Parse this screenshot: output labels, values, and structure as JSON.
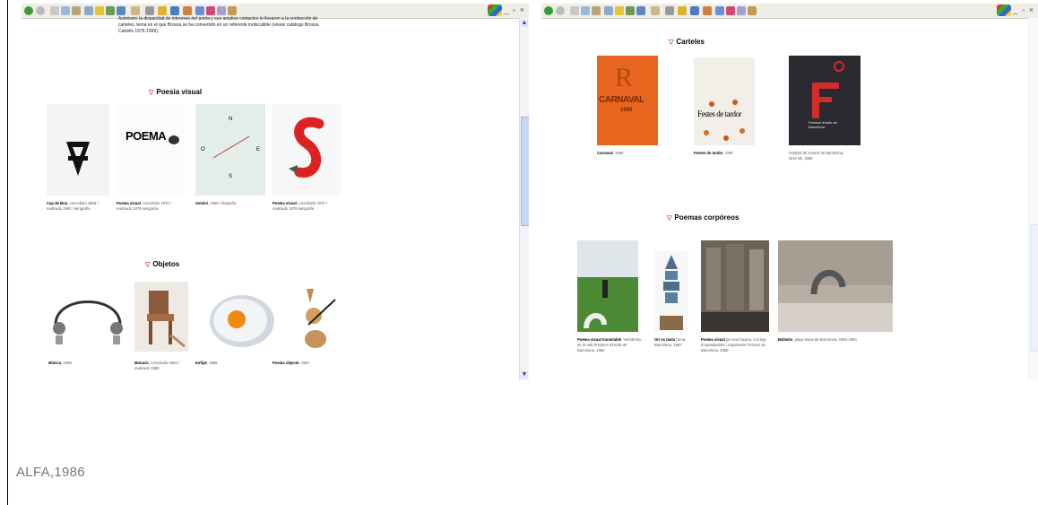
{
  "caption": "ALFA,1986",
  "left_panel": {
    "intro_text": "Asimismo la disparidad de intereses del poeta y sus amplios contactos lo llevaron a la confección de carteles, tema en el que Brossa se ha convertido en un referente indiscutible (véase catálogo Brossa Cartells 1975-1999).",
    "section_visual": "Poesia visual",
    "visual_items": [
      {
        "title": "Cap de Bou",
        "rest": ", concebido 1969 / realizado 1982 / serigrafía"
      },
      {
        "title": "Poema visual",
        "rest": ", concebido 1970 / realizado 1979 serigrafía"
      },
      {
        "title": "Sololoi",
        "rest": ", 1969 / litografía"
      },
      {
        "title": "Poema visual",
        "rest": ", concebido 1970 / realizado 1979 serigrafía"
      }
    ],
    "poema_word": "POEMA",
    "section_objects": "Objetos",
    "object_items": [
      {
        "title": "Música",
        "rest": ", 1965"
      },
      {
        "title": "Mutacio",
        "rest": ", concebido 1964 / realizado 1989"
      },
      {
        "title": "Enfijat",
        "rest": ", 1968"
      },
      {
        "title": "Poema objecte",
        "rest": ", 1967"
      }
    ]
  },
  "right_panel": {
    "section_posters": "Carteles",
    "poster_items": [
      {
        "title": "Carnaval",
        "rest": ", 1980"
      },
      {
        "title": "Festes de tardor",
        "rest": ", 1987"
      },
      {
        "title": "",
        "rest": "Festival de verano de Barcelona: Grec 85, 1985"
      }
    ],
    "poster1_text": "CARNAVAL",
    "poster1_year": "1980",
    "poster2_text": "Festes de tardor",
    "poster3_text": "Festival d'estiu de Barcelona",
    "section_corporeal": "Poemas corpóreos",
    "corporeal_items": [
      {
        "title": "Poema visual transitable",
        "rest": ", Velòdromo de la Vall d'Hebron d'Horta de Barcelona, 1984"
      },
      {
        "title": "Ori so bada",
        "rest": " l'ama, Barcelona, 1987"
      },
      {
        "title": "Poema visual",
        "rest": " per una façana, Col·legi d'Aparelladors i Arquitectes Tècnics de Barcelona, 1990"
      },
      {
        "title": "Bàlimbs",
        "rest": ", plaça Nova de Barcelona, 1991-1994"
      }
    ]
  },
  "window_controls": "_ ▫ ×",
  "colors": {
    "accent_red": "#cc3333",
    "poster_orange": "#e8651f",
    "poster_dark": "#2a2a30"
  }
}
